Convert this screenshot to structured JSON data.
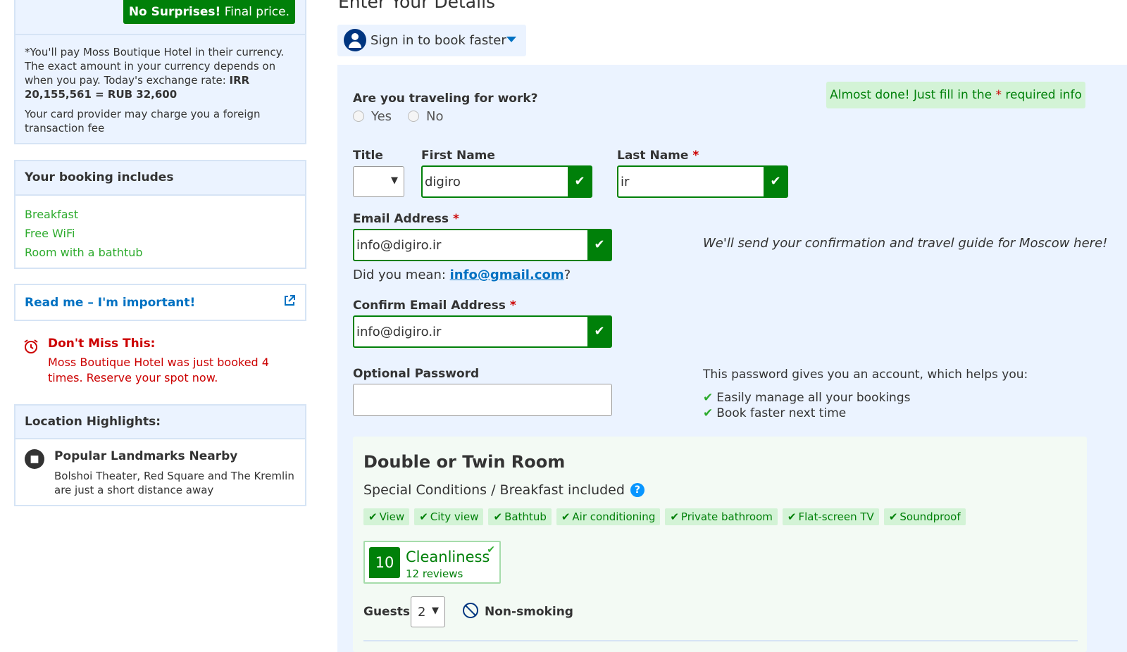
{
  "price_box": {
    "badge_bold": "No Surprises!",
    "badge_rest": " Final price.",
    "currency_note_prefix": "*You'll pay Moss Boutique Hotel in their currency. The exact amount in your currency depends on when you pay. Today's exchange rate: ",
    "currency_note_bold": "Today's exchange rate: IRR 20,155,561 = RUB 32,600",
    "card_fee_note": "Your card provider may charge you a foreign transaction fee"
  },
  "booking_includes": {
    "title": "Your booking includes",
    "items": [
      "Breakfast",
      "Free WiFi",
      "Room with a bathtub"
    ]
  },
  "read_me": {
    "label": "Read me – I'm important!"
  },
  "dont_miss": {
    "title": "Don't Miss This:",
    "text": "Moss Boutique Hotel was just booked 4 times. Reserve your spot now."
  },
  "location": {
    "title": "Location Highlights:",
    "item_title": "Popular Landmarks Nearby",
    "item_text": "Bolshoi Theater, Red Square and The Kremlin are just a short distance away"
  },
  "page": {
    "title": "Enter Your Details"
  },
  "signin": {
    "label": "Sign in to book faster"
  },
  "form": {
    "almost_done_prefix": "Almost done! Just fill in the ",
    "almost_done_star": "*",
    "almost_done_suffix": " required info",
    "work_question": "Are you traveling for work?",
    "yes": "Yes",
    "no": "No",
    "title_label": "Title",
    "first_name_label": "First Name",
    "first_name_value": "digiro",
    "last_name_label": "Last Name",
    "last_name_value": "ir",
    "email_label": "Email Address",
    "email_value": "info@digiro.ir",
    "email_hint": "We'll send your confirmation and travel guide for Moscow here!",
    "did_you_mean_prefix": "Did you mean: ",
    "did_you_mean_link": "info@gmail.com",
    "did_you_mean_suffix": "?",
    "confirm_email_label": "Confirm Email Address",
    "confirm_email_value": "info@digiro.ir",
    "password_label": "Optional Password",
    "password_help": "This password gives you an account, which helps you:",
    "password_benefits": [
      "Easily manage all your bookings",
      "Book faster next time"
    ],
    "required_star": "*",
    "check": "✔"
  },
  "room": {
    "title": "Double or Twin Room",
    "subtitle": "Special Conditions / Breakfast included",
    "facilities": [
      "View",
      "City view",
      "Bathtub",
      "Air conditioning",
      "Private bathroom",
      "Flat-screen TV",
      "Soundproof"
    ],
    "cleanliness_score": "10",
    "cleanliness_label": "Cleanliness",
    "cleanliness_reviews": "12 reviews",
    "guests_label": "Guests:",
    "guests_value": "2",
    "non_smoking": "Non-smoking"
  },
  "colors": {
    "brand_blue": "#003580",
    "link_blue": "#0071c2",
    "success_green": "#008009",
    "alert_red": "#cc0000",
    "panel_blue": "#ebf3ff"
  },
  "icons": {
    "external": "external-link-icon",
    "alarm": "alarm-clock-icon",
    "landmark": "landmark-icon",
    "user": "user-icon",
    "help": "help-icon",
    "no_smoking": "no-smoking-icon"
  }
}
